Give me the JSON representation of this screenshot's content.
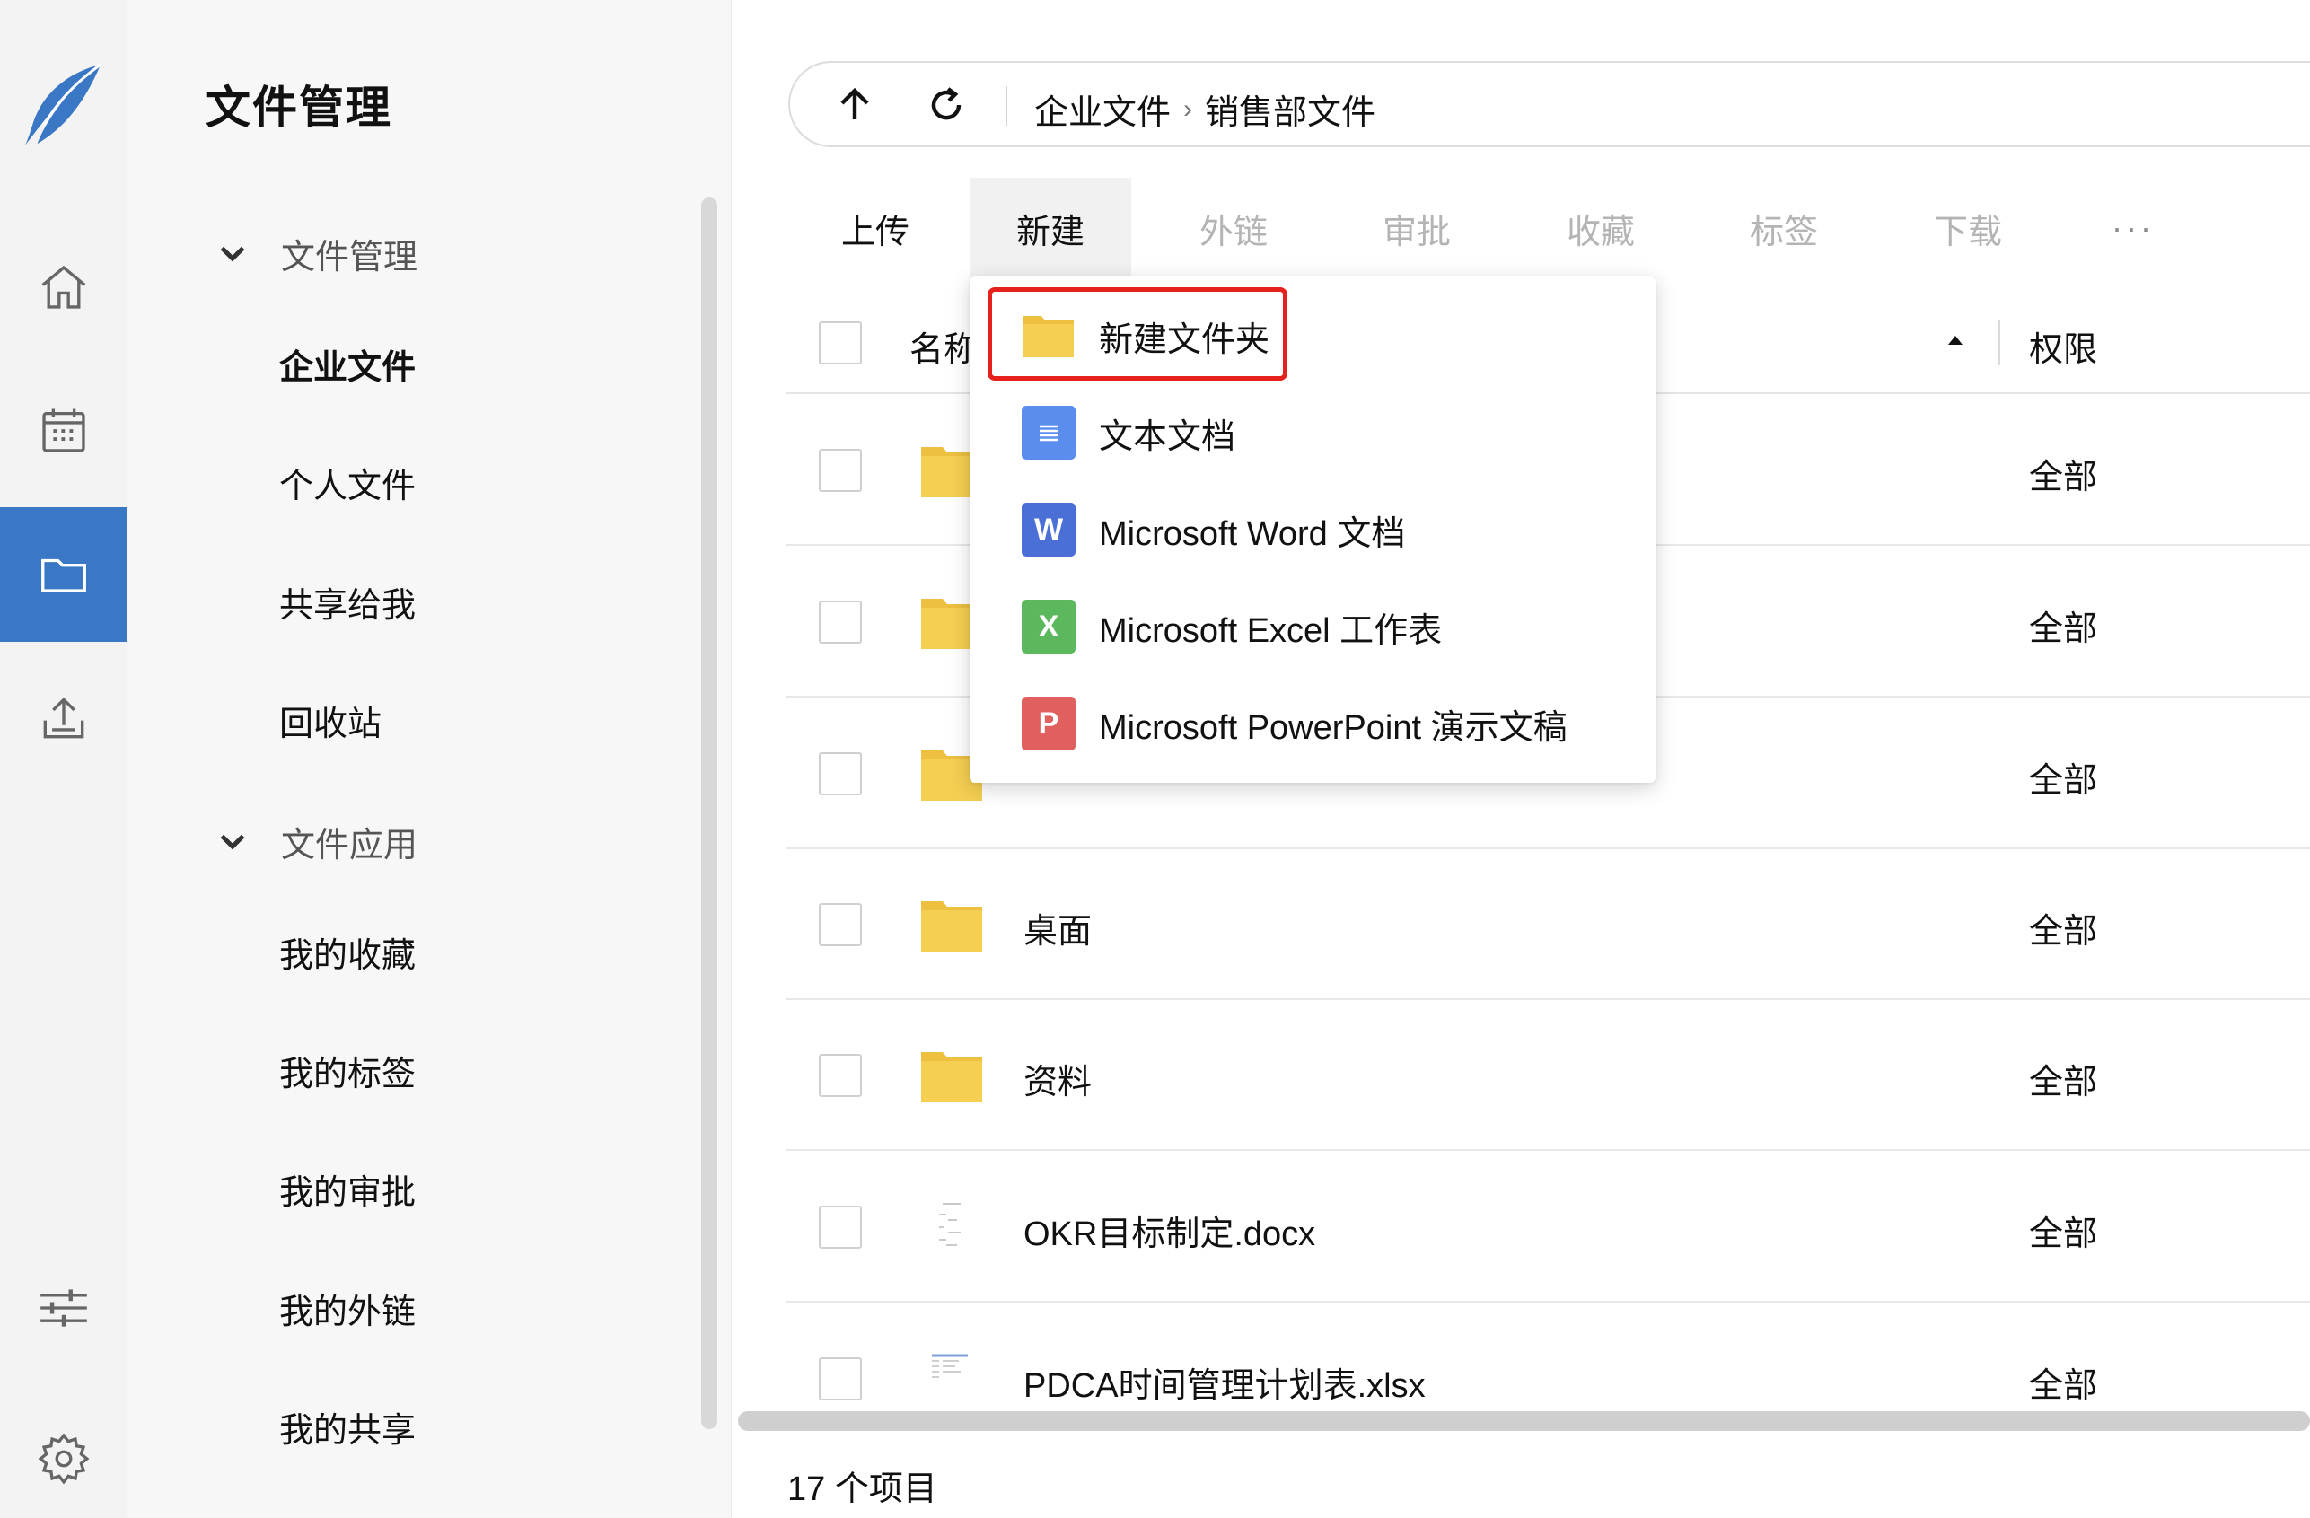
{
  "rail": {
    "items": [
      {
        "icon": "home-icon"
      },
      {
        "icon": "calendar-icon"
      },
      {
        "icon": "folder-icon",
        "active": true
      },
      {
        "icon": "upload-icon"
      }
    ],
    "bottom": [
      {
        "icon": "sliders-icon"
      },
      {
        "icon": "gear-icon"
      }
    ],
    "accent": "#3a78c5"
  },
  "nav": {
    "title": "文件管理",
    "groups": [
      {
        "label": "文件管理",
        "items": [
          "企业文件",
          "个人文件",
          "共享给我",
          "回收站"
        ]
      },
      {
        "label": "文件应用",
        "items": [
          "我的收藏",
          "我的标签",
          "我的审批",
          "我的外链",
          "我的共享"
        ]
      }
    ],
    "active_item": "企业文件"
  },
  "address": {
    "crumbs": [
      "企业文件",
      "销售部文件"
    ],
    "separator": "›"
  },
  "toolbar": {
    "upload": "上传",
    "new": "新建",
    "share_link": "外链",
    "approve": "审批",
    "favorite": "收藏",
    "tag": "标签",
    "download": "下载",
    "more": "···"
  },
  "table": {
    "col_name": "名称",
    "col_perm": "权限",
    "rows": [
      {
        "name": "",
        "perm": "全部",
        "type": "folder"
      },
      {
        "name": "",
        "perm": "全部",
        "type": "folder"
      },
      {
        "name": "",
        "perm": "全部",
        "type": "folder"
      },
      {
        "name": "桌面",
        "perm": "全部",
        "type": "folder"
      },
      {
        "name": "资料",
        "perm": "全部",
        "type": "folder"
      },
      {
        "name": "OKR目标制定.docx",
        "perm": "全部",
        "type": "docx"
      },
      {
        "name": "PDCA时间管理计划表.xlsx",
        "perm": "全部",
        "type": "xlsx"
      }
    ]
  },
  "footer": {
    "count": "17 个项目"
  },
  "new_menu": {
    "items": [
      {
        "label": "新建文件夹",
        "icon": "folder-icon",
        "highlighted": true
      },
      {
        "label": "文本文档",
        "icon": "text-doc-icon",
        "color": "#5b8def"
      },
      {
        "label": "Microsoft Word 文档",
        "icon": "word-icon",
        "letter": "W",
        "color": "#4a6fd6"
      },
      {
        "label": "Microsoft Excel 工作表",
        "icon": "excel-icon",
        "letter": "X",
        "color": "#5cb85c"
      },
      {
        "label": "Microsoft PowerPoint 演示文稿",
        "icon": "powerpoint-icon",
        "letter": "P",
        "color": "#e06060"
      }
    ],
    "highlight_color": "#e4211c"
  },
  "colors": {
    "folder": "#f5cf52",
    "folder_tab": "#edc040"
  }
}
